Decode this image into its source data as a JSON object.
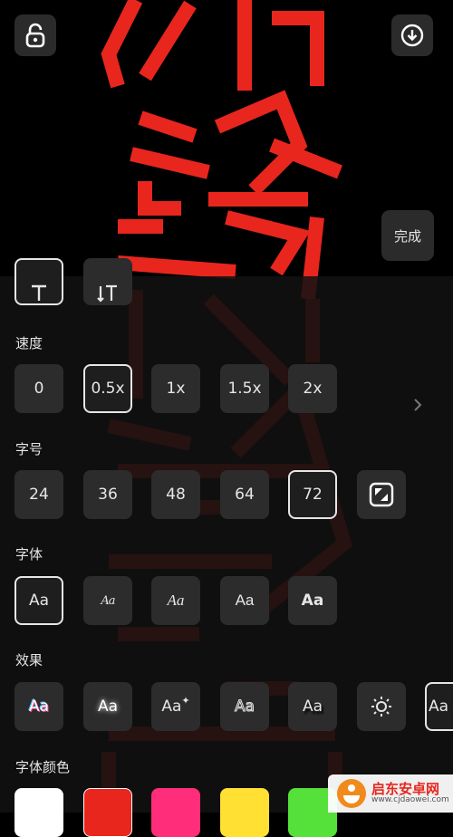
{
  "header": {
    "done_label": "完成"
  },
  "speed": {
    "label": "速度",
    "options": [
      "0",
      "0.5x",
      "1x",
      "1.5x",
      "2x"
    ]
  },
  "font_size": {
    "label": "字号",
    "options": [
      "24",
      "36",
      "48",
      "64",
      "72"
    ]
  },
  "font": {
    "label": "字体",
    "options": [
      "Aa",
      "Aa",
      "Aa",
      "Aa",
      "Aa"
    ]
  },
  "effect": {
    "label": "效果",
    "options": [
      "Aa",
      "Aa",
      "Aa",
      "Aa",
      "Aa",
      "",
      "Aa"
    ]
  },
  "font_color": {
    "label": "字体颜色",
    "swatches": [
      "#ffffff",
      "#e8261e",
      "#ff2d7a",
      "#ffe033",
      "#56e03a"
    ]
  },
  "watermark": {
    "text_cn": "启东安卓网",
    "url": "www.cjdaowei.com"
  },
  "colors": {
    "accent_red": "#e8261e",
    "panel": "#121212",
    "tile": "#2c2c2c"
  }
}
